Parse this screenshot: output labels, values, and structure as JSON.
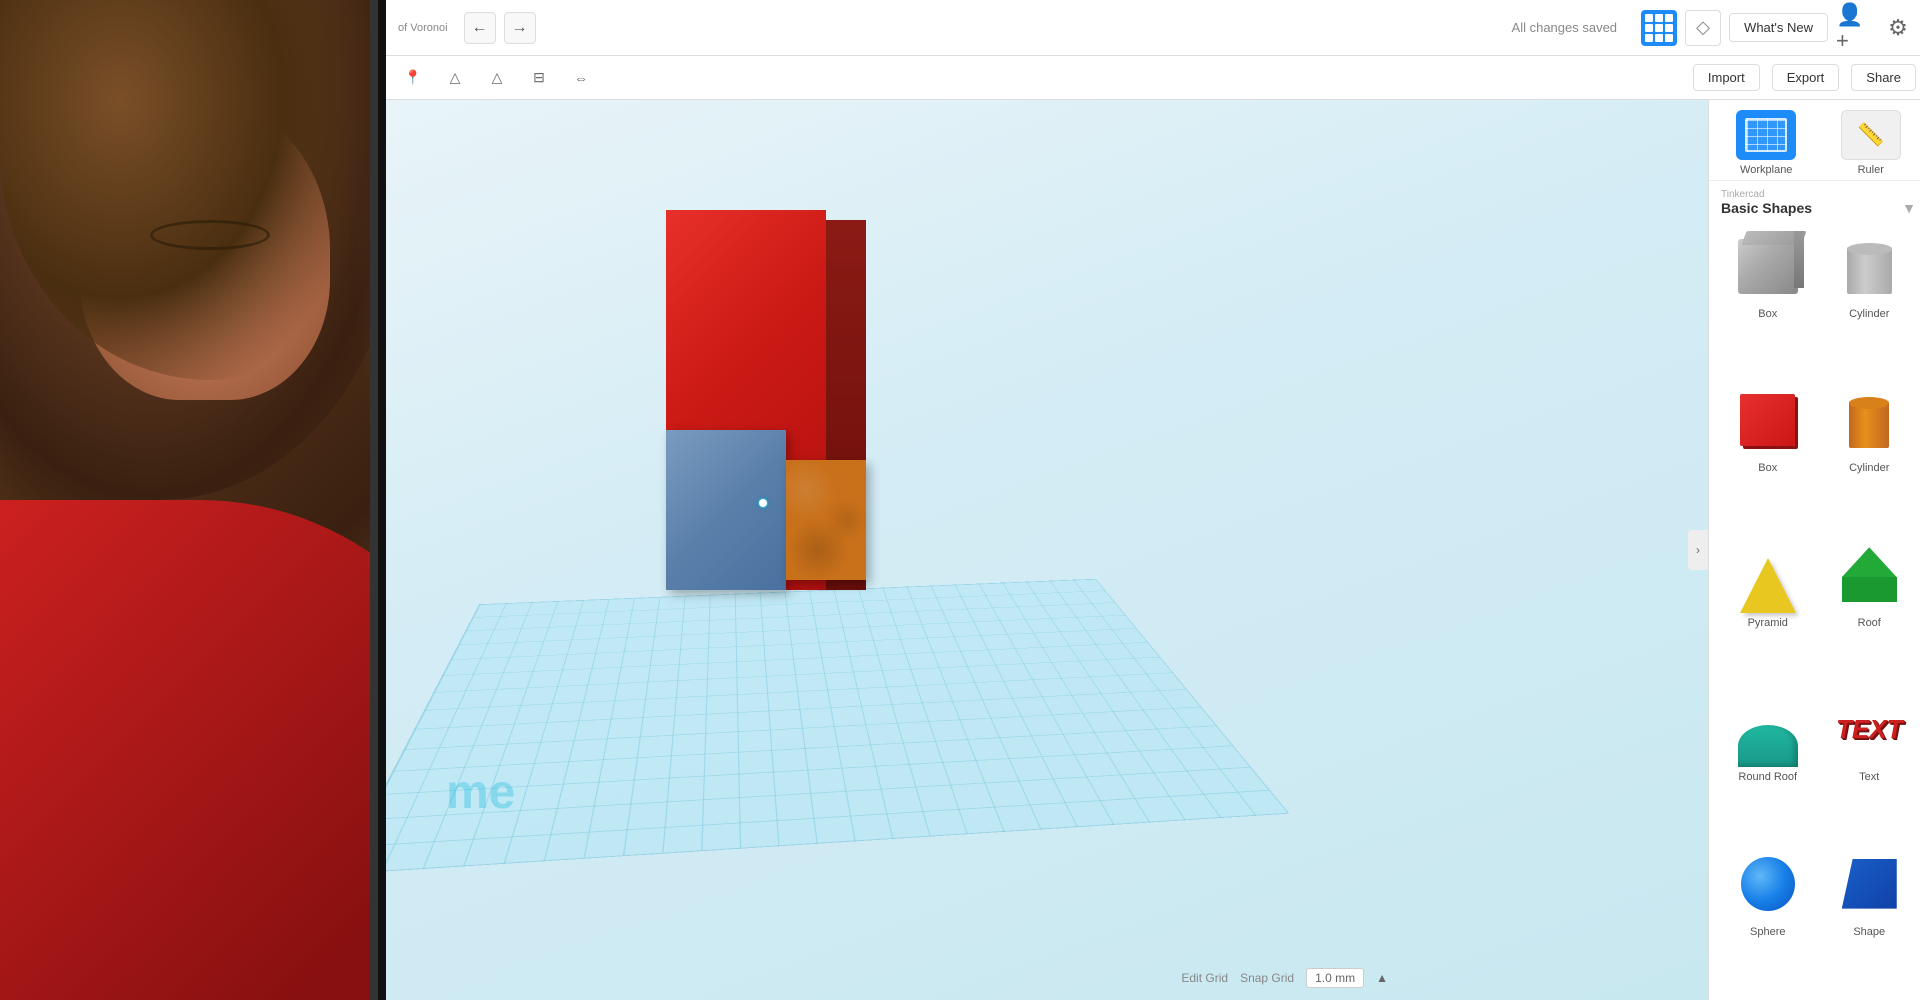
{
  "app": {
    "title": "Tinkercad",
    "subtitle": "of Voronoi",
    "status": "All changes saved"
  },
  "toolbar": {
    "undo_label": "←",
    "redo_label": "→",
    "whats_new_label": "What's New",
    "import_label": "Import",
    "export_label": "Export",
    "share_label": "Share"
  },
  "tools": {
    "workplane_label": "Workplane",
    "ruler_label": "Ruler"
  },
  "shapes_panel": {
    "section_subtitle": "Tinkercad",
    "section_title": "Basic Shapes",
    "items": [
      {
        "name": "Box",
        "type": "box-gray"
      },
      {
        "name": "Cylinder",
        "type": "cylinder-gray"
      },
      {
        "name": "Box",
        "type": "box-red"
      },
      {
        "name": "Cylinder",
        "type": "cylinder-orange"
      },
      {
        "name": "Pyramid",
        "type": "pyramid-yellow"
      },
      {
        "name": "Roof",
        "type": "roof-green"
      },
      {
        "name": "Round Roof",
        "type": "round-roof-teal"
      },
      {
        "name": "Text",
        "type": "text-red"
      },
      {
        "name": "Sphere",
        "type": "sphere-blue"
      },
      {
        "name": "Shape",
        "type": "shape-blue"
      }
    ]
  },
  "viewport": {
    "watermark": "me",
    "cursor_visible": true
  },
  "grid": {
    "edit_grid_label": "Edit Grid",
    "snap_grid_label": "Snap Grid",
    "snap_value": "1.0 mm",
    "snap_unit": "▲"
  },
  "colors": {
    "primary_blue": "#1d8cf8",
    "toolbar_bg": "#ffffff",
    "viewport_bg": "#d4ecf5",
    "panel_bg": "#ffffff"
  }
}
